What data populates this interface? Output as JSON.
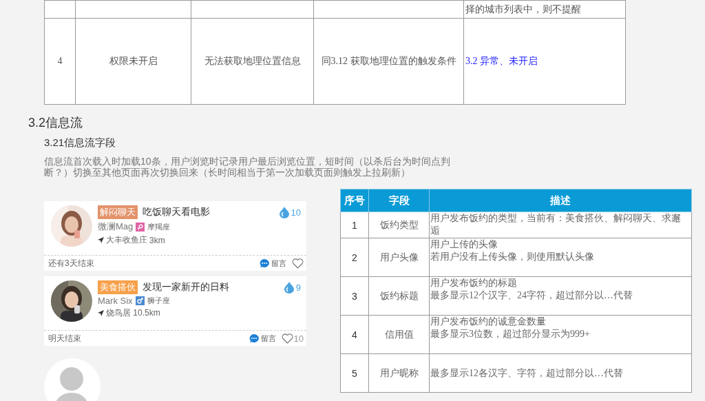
{
  "top_table": {
    "rows": [
      {
        "cells": [
          null,
          null,
          null,
          null,
          {
            "text": "择的城市列表中，则不提醒",
            "kind": "text"
          }
        ]
      },
      {
        "cells": [
          {
            "text": "4",
            "kind": "text"
          },
          {
            "text": "权限未开启",
            "kind": "text"
          },
          {
            "text": "无法获取地理位置信息",
            "kind": "text"
          },
          {
            "text": "同3.12 获取地理位置的触发条件",
            "kind": "text"
          },
          {
            "text": "3.2 异常、未开启",
            "kind": "link"
          }
        ]
      }
    ]
  },
  "section": {
    "heading": "3.2信息流",
    "subheading": "3.21信息流字段",
    "paragraph": "信息流首次载入时加载10条，用户浏览时记录用户最后浏览位置，短时间（以杀后台为时间点判断？）切换至其他页面再次切换回来（长时间相当于第一次加载页面则触发上拉刷新）"
  },
  "feed": [
    {
      "tag": "解闷聊天",
      "color": "#e3936b",
      "title": "吃饭聊天看电影",
      "credit": "10",
      "name": "微澜Mag",
      "kind": "female",
      "zodiac": "摩羯座",
      "location": "大丰收鱼庄",
      "distance": "3km",
      "ends": "还有3天结束",
      "comment": "留言"
    },
    {
      "tag": "美食搭伙",
      "color": "#f7a04a",
      "title": "发现一家新开的日料",
      "credit": "9",
      "name": "Mark Six",
      "kind": "male",
      "zodiac": "狮子座",
      "location": "烧鸟居 10.5km",
      "ends": "明天结束",
      "comment": "留言",
      "likes": "10"
    }
  ],
  "fields_table": {
    "columns": [
      "序号",
      "字段",
      "描述"
    ],
    "rows": [
      {
        "number": "1",
        "field": "饭约类型",
        "description": [
          "用户发布饭约的类型，当前有：美食搭伙、解闷聊天、求邂逅"
        ]
      },
      {
        "number": "2",
        "field": "用户头像",
        "description": [
          "用户上传的头像",
          "若用户没有上传头像，则使用默认头像"
        ]
      },
      {
        "number": "3",
        "field": "饭约标题",
        "description": [
          "用户发布饭约的标题",
          "最多显示12个汉字、24字符，超过部分以…代替"
        ]
      },
      {
        "number": "4",
        "field": "信用值",
        "description": [
          "用户发布饭约的诚意金数量",
          "最多显示3位数，超过部分显示为999+"
        ]
      },
      {
        "number": "5",
        "field": "用户昵称",
        "description": [
          "最多显示12各汉字、字符，超过部分以…代替"
        ]
      }
    ]
  }
}
